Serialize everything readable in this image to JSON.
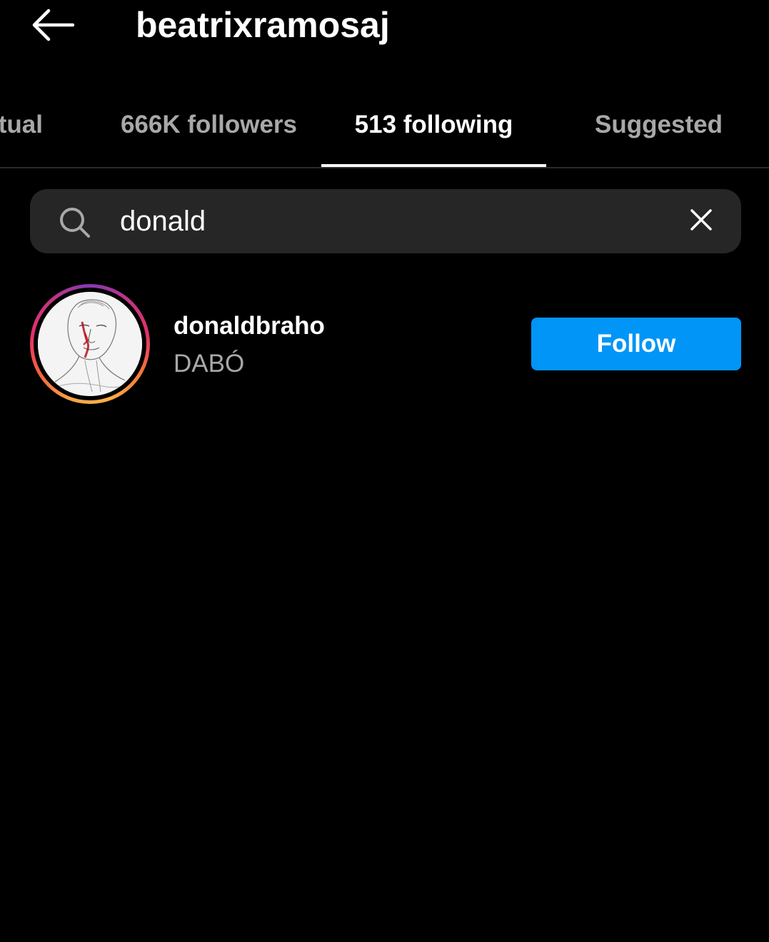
{
  "header": {
    "back_icon": "arrow-left-icon",
    "title": "beatrixramosaj"
  },
  "tabs": [
    {
      "label": "Mutual",
      "active": false
    },
    {
      "label": "666K followers",
      "active": false
    },
    {
      "label": "513 following",
      "active": true
    },
    {
      "label": "Suggested",
      "active": false
    }
  ],
  "search": {
    "icon": "search-icon",
    "value": "donald",
    "clear_icon": "close-icon"
  },
  "results": [
    {
      "username": "donaldbraho",
      "full_name": "DABÓ",
      "button_label": "Follow",
      "has_story_ring": true
    }
  ],
  "colors": {
    "background": "#000000",
    "search_bg": "#262626",
    "secondary_text": "#a8a8a8",
    "follow_button": "#0095f6"
  }
}
